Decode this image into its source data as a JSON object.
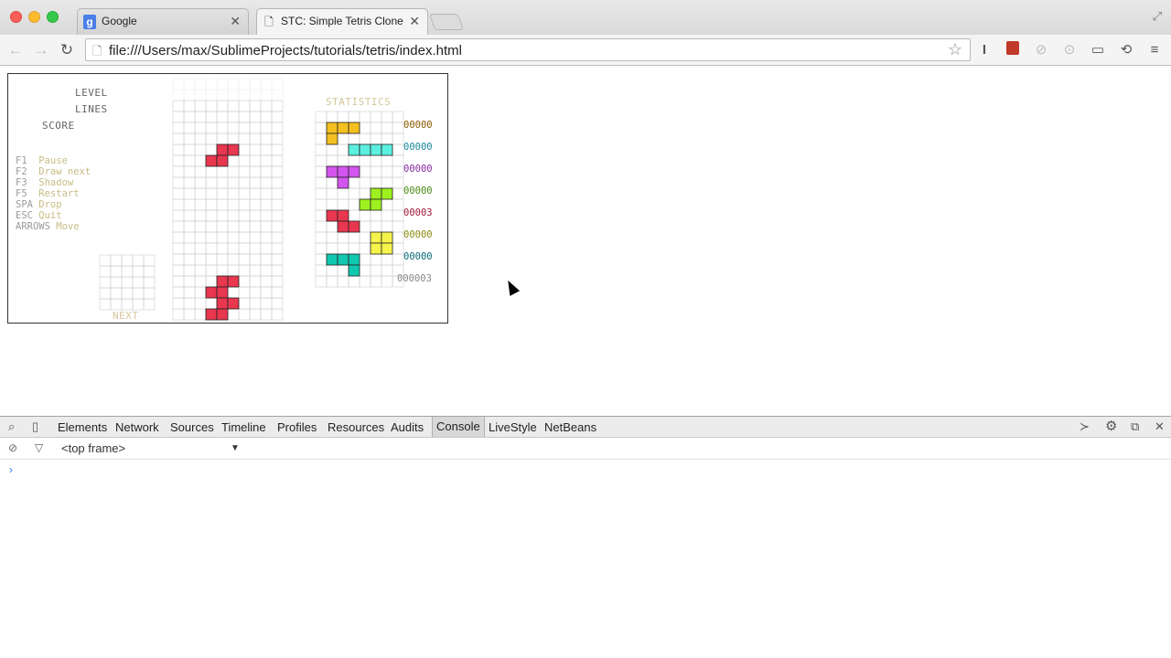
{
  "browser": {
    "tabs": [
      {
        "title": "Google",
        "icon": "google-g-icon"
      },
      {
        "title": "STC: Simple Tetris Clone",
        "icon": "page-icon"
      }
    ],
    "url": "file:///Users/max/SublimeProjects/tutorials/tetris/index.html"
  },
  "game": {
    "labels": {
      "level": "LEVEL",
      "lines": "LINES",
      "score": "SCORE",
      "statistics": "STATISTICS",
      "next": "NEXT"
    },
    "keys": [
      {
        "key": "F1 ",
        "action": " Pause"
      },
      {
        "key": "F2 ",
        "action": " Draw next"
      },
      {
        "key": "F3 ",
        "action": " Shadow"
      },
      {
        "key": "F5 ",
        "action": " Restart"
      },
      {
        "key": "SPA",
        "action": " Drop"
      },
      {
        "key": "ESC",
        "action": " Quit"
      },
      {
        "key": "ARROWS",
        "action": " Move"
      }
    ],
    "colors": {
      "z": "#e8374f",
      "j": "#f4c020",
      "i": "#5cf0e0",
      "t": "#d454f0",
      "s": "#9ef020",
      "o": "#f6f44a",
      "l": "#10c8b0"
    },
    "stats": [
      {
        "piece": "J",
        "count": "00000",
        "color": "#8a5a00"
      },
      {
        "piece": "I",
        "count": "00000",
        "color": "#1a8a9a"
      },
      {
        "piece": "T",
        "count": "00000",
        "color": "#8a2aa0"
      },
      {
        "piece": "S",
        "count": "00000",
        "color": "#4a8a10"
      },
      {
        "piece": "Z",
        "count": "00003",
        "color": "#a01a3a"
      },
      {
        "piece": "O",
        "count": "00000",
        "color": "#8a8a10"
      },
      {
        "piece": "L",
        "count": "00000",
        "color": "#0a6a7a"
      }
    ],
    "total": "000003"
  },
  "devtools": {
    "tabs": [
      "Elements",
      "Network",
      "Sources",
      "Timeline",
      "Profiles",
      "Resources",
      "Audits",
      "Console",
      "LiveStyle",
      "NetBeans"
    ],
    "selected_tab": "Console",
    "frame": "<top frame>",
    "prompt": "›"
  }
}
